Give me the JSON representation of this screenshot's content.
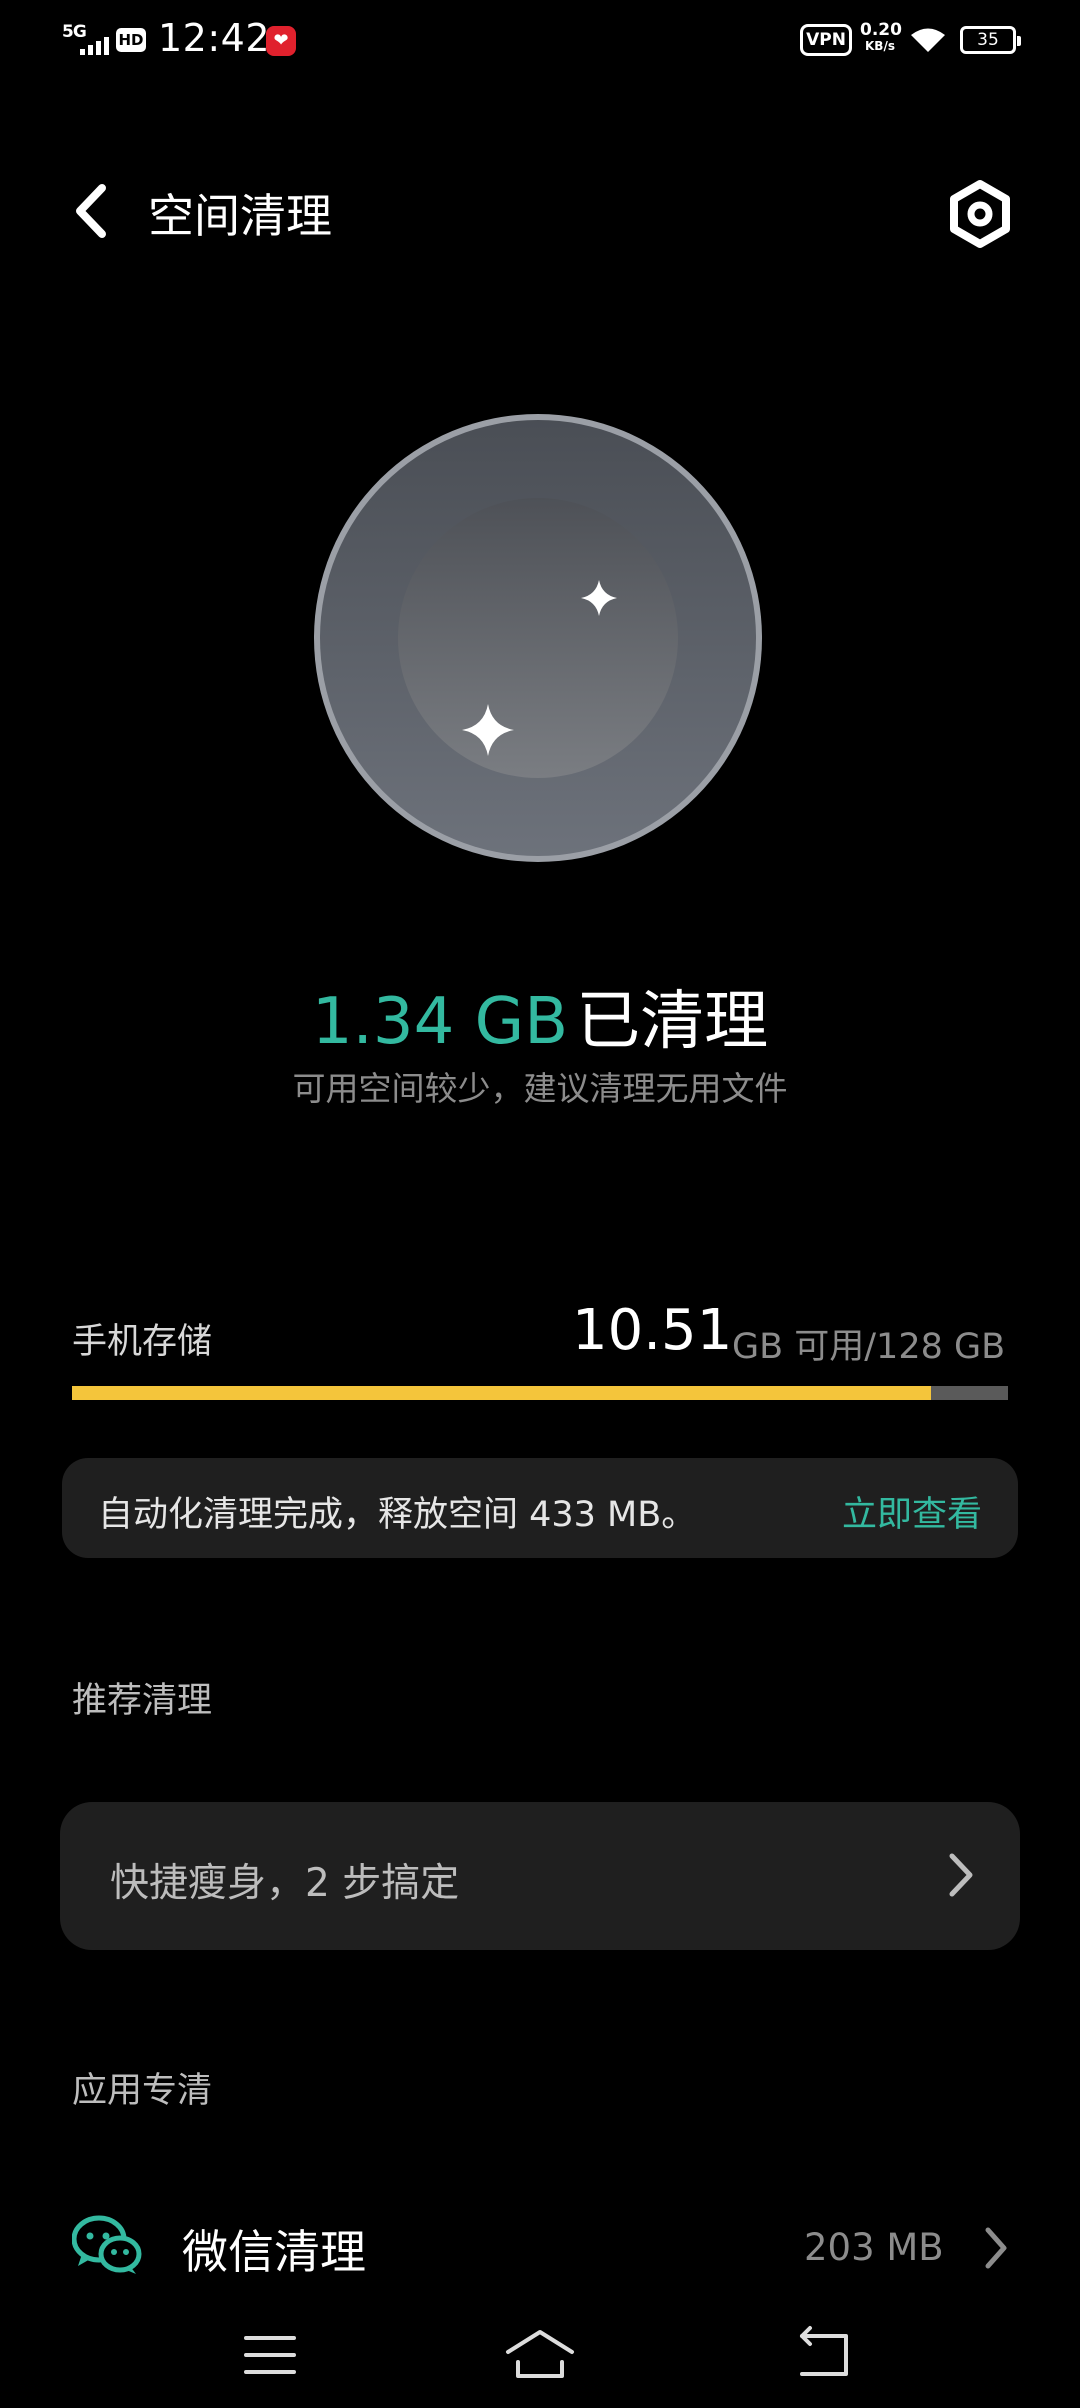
{
  "status_bar": {
    "network": "5G",
    "hd": "HD",
    "time": "12:42",
    "vpn": "VPN",
    "speed_value": "0.20",
    "speed_unit": "KB/s",
    "battery": "35"
  },
  "header": {
    "title": "空间清理"
  },
  "result": {
    "amount": "1.34 GB",
    "suffix": "已清理",
    "hint": "可用空间较少，建议清理无用文件"
  },
  "storage": {
    "label": "手机存储",
    "free_value": "10.51",
    "free_suffix": "GB 可用/128 GB",
    "used_fraction": 0.918
  },
  "notice": {
    "text": "自动化清理完成，释放空间 433 MB。",
    "link": "立即查看"
  },
  "recommend": {
    "section_title": "推荐清理",
    "item_label": "快捷瘦身，2 步搞定"
  },
  "app_clean": {
    "section_title": "应用专清",
    "items": [
      {
        "label": "微信清理",
        "size": "203 MB"
      }
    ]
  },
  "colors": {
    "accent": "#33b9a0",
    "storage_fill": "#f4c53b",
    "storage_track": "#5a5a5a",
    "card_bg": "#1f1f1f"
  },
  "icons": {
    "back": "chevron-left-icon",
    "settings": "hexagon-gear-icon",
    "wechat": "wechat-icon",
    "chevron": "chevron-right-icon"
  }
}
